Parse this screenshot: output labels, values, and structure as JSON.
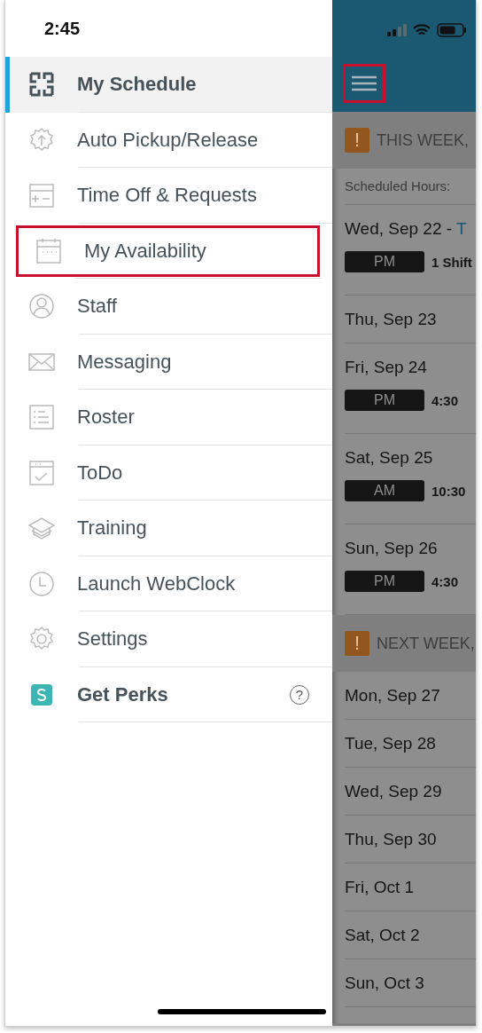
{
  "status_bar": {
    "time": "2:45"
  },
  "menu": {
    "items": [
      {
        "label": "My Schedule",
        "kind": "link",
        "selected": true,
        "highlighted": false
      },
      {
        "label": "Auto Pickup/Release",
        "kind": "link",
        "selected": false,
        "highlighted": false
      },
      {
        "label": "Time Off & Requests",
        "kind": "link",
        "selected": false,
        "highlighted": false
      },
      {
        "label": "My Availability",
        "kind": "link",
        "selected": false,
        "highlighted": true
      },
      {
        "label": "Staff",
        "kind": "link",
        "selected": false,
        "highlighted": false
      },
      {
        "label": "Messaging",
        "kind": "link",
        "selected": false,
        "highlighted": false
      },
      {
        "label": "Roster",
        "kind": "link",
        "selected": false,
        "highlighted": false
      },
      {
        "label": "ToDo",
        "kind": "link",
        "selected": false,
        "highlighted": false
      },
      {
        "label": "Training",
        "kind": "link",
        "selected": false,
        "highlighted": false
      },
      {
        "label": "Launch WebClock",
        "kind": "link",
        "selected": false,
        "highlighted": false
      },
      {
        "label": "Settings",
        "kind": "link",
        "selected": false,
        "highlighted": false
      },
      {
        "label": "Get Perks",
        "kind": "promo",
        "selected": false,
        "highlighted": false,
        "help": "?"
      }
    ]
  },
  "schedule": {
    "menu_button_highlighted": true,
    "sections": [
      {
        "badge": "!",
        "title": "THIS WEEK,",
        "hours": "Scheduled Hours:",
        "days": [
          {
            "date": "Wed, Sep 22 -",
            "link": "T",
            "shift": {
              "period": "PM",
              "detail": "1 Shift"
            }
          },
          {
            "date": "Thu, Sep 23"
          },
          {
            "date": "Fri, Sep 24",
            "shift": {
              "period": "PM",
              "detail": "4:30"
            }
          },
          {
            "date": "Sat, Sep 25",
            "shift": {
              "period": "AM",
              "detail": "10:30"
            }
          },
          {
            "date": "Sun, Sep 26",
            "shift": {
              "period": "PM",
              "detail": "4:30"
            }
          }
        ]
      },
      {
        "badge": "!",
        "title": "NEXT WEEK,",
        "days": [
          {
            "date": "Mon, Sep 27"
          },
          {
            "date": "Tue, Sep 28"
          },
          {
            "date": "Wed, Sep 29"
          },
          {
            "date": "Thu, Sep 30"
          },
          {
            "date": "Fri, Oct 1"
          },
          {
            "date": "Sat, Oct 2"
          },
          {
            "date": "Sun, Oct 3"
          }
        ]
      }
    ]
  }
}
